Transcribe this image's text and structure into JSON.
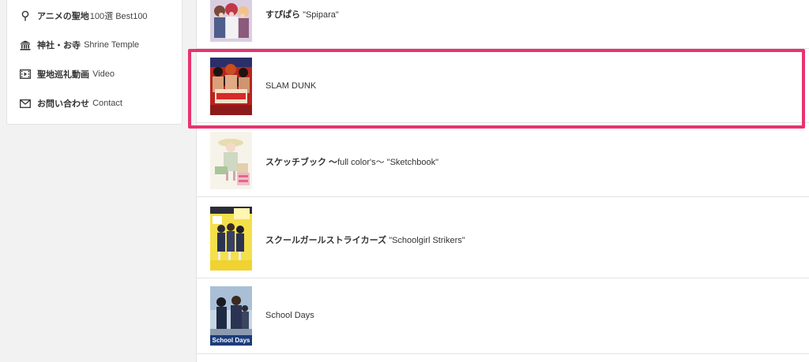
{
  "sidebar": {
    "items": [
      {
        "icon": "map-pin-icon",
        "jp": "アニメの聖地",
        "en": "100選 Best100"
      },
      {
        "icon": "temple-icon",
        "jp": "神社・お寺",
        "en": "Shrine Temple"
      },
      {
        "icon": "film-icon",
        "jp": "聖地巡礼動画",
        "en": "Video"
      },
      {
        "icon": "mail-icon",
        "jp": "お問い合わせ",
        "en": "Contact"
      }
    ]
  },
  "list": {
    "rows": [
      {
        "jp": "すぴぱら",
        "en": "\"Spipara\"",
        "thumb": "spipara-cover"
      },
      {
        "jp": "",
        "en": "SLAM DUNK",
        "thumb": "slam-dunk-cover"
      },
      {
        "jp": "スケッチブック 〜",
        "en": "full color's〜 \"Sketchbook\"",
        "thumb": "sketchbook-cover"
      },
      {
        "jp": "スクールガールストライカーズ",
        "en": "\"Schoolgirl Strikers\"",
        "thumb": "schoolgirl-strikers-cover"
      },
      {
        "jp": "",
        "en": "School Days",
        "thumb": "school-days-cover"
      }
    ]
  },
  "thumbs": {
    "school_days_logo": "School Days"
  },
  "colors": {
    "highlight": "#e8336f",
    "background": "#f2f2f2",
    "border": "#e3e3e3"
  }
}
